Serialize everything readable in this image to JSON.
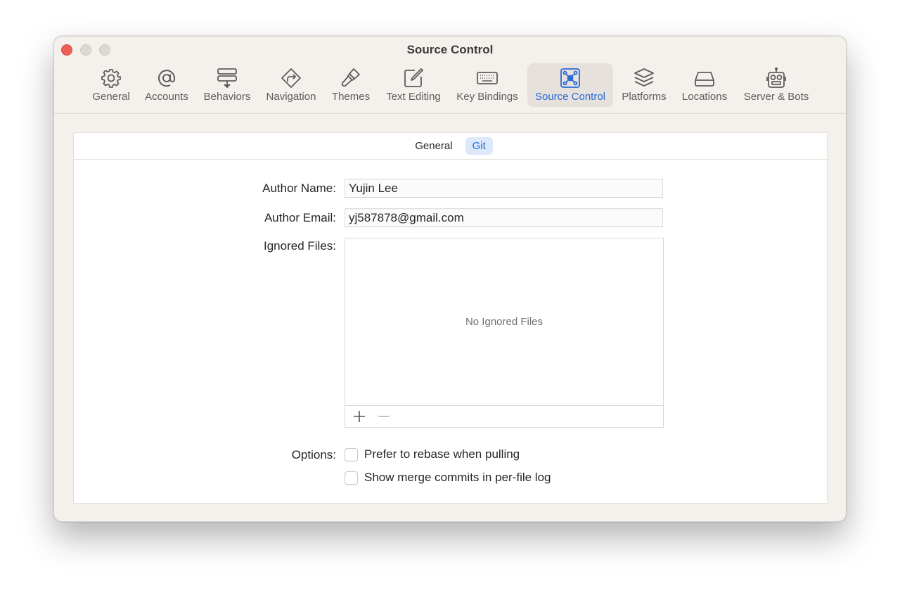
{
  "window": {
    "title": "Source Control"
  },
  "toolbar": {
    "items": [
      {
        "label": "General",
        "icon": "gear-icon"
      },
      {
        "label": "Accounts",
        "icon": "at-icon"
      },
      {
        "label": "Behaviors",
        "icon": "behaviors-icon"
      },
      {
        "label": "Navigation",
        "icon": "navigation-icon"
      },
      {
        "label": "Themes",
        "icon": "paintbrush-icon"
      },
      {
        "label": "Text Editing",
        "icon": "pencil-square-icon"
      },
      {
        "label": "Key Bindings",
        "icon": "keyboard-icon"
      },
      {
        "label": "Source Control",
        "icon": "source-control-icon"
      },
      {
        "label": "Platforms",
        "icon": "layers-icon"
      },
      {
        "label": "Locations",
        "icon": "drive-icon"
      },
      {
        "label": "Server & Bots",
        "icon": "robot-icon"
      }
    ],
    "selected": "Source Control"
  },
  "tabs": {
    "general": "General",
    "git": "Git",
    "selected": "Git"
  },
  "form": {
    "author_name_label": "Author Name:",
    "author_name_value": "Yujin Lee",
    "author_email_label": "Author Email:",
    "author_email_value": "yj587878@gmail.com",
    "ignored_files_label": "Ignored Files:",
    "ignored_files_empty": "No Ignored Files",
    "options_label": "Options:",
    "options": [
      {
        "label": "Prefer to rebase when pulling",
        "checked": false
      },
      {
        "label": "Show merge commits in per-file log",
        "checked": false
      }
    ]
  },
  "colors": {
    "accent": "#2a6ad6",
    "close_button": "#ec5f57",
    "window_bg": "#f4f0eb"
  }
}
